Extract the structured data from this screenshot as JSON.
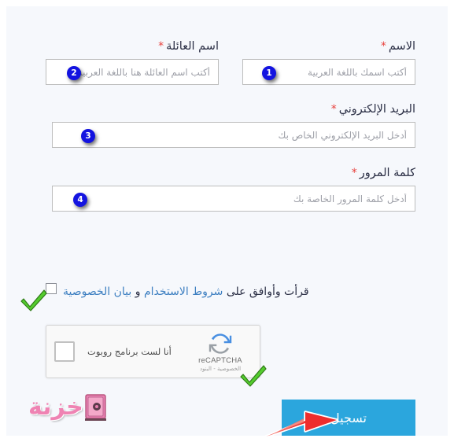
{
  "page": {
    "background_color": "#f6f8fc",
    "accent_blue": "#2ba6dd",
    "badge_color": "#1313e0",
    "link_color": "#3d7fc1",
    "required_color": "#e8413c"
  },
  "form": {
    "fields": [
      {
        "id": "first-name",
        "label": "الاسم",
        "required_mark": "*",
        "placeholder": "أكتب اسمك باللغة العربية",
        "value": "",
        "badge": "1"
      },
      {
        "id": "family-name",
        "label": "اسم العائلة",
        "required_mark": "*",
        "placeholder": "أكتب اسم العائلة هنا باللغة العربية",
        "value": "",
        "badge": "2"
      },
      {
        "id": "email",
        "label": "البريد الإلكتروني",
        "required_mark": "*",
        "placeholder": "أدخل البريد الإلكتروني الخاص بك",
        "value": "",
        "badge": "3"
      },
      {
        "id": "password",
        "label": "كلمة المرور",
        "required_mark": "*",
        "placeholder": "أدخل كلمة المرور الخاصة بك",
        "value": "",
        "badge": "4"
      }
    ],
    "terms": {
      "prefix": "قرأت وأوافق على",
      "link_terms": "شروط الاستخدام",
      "conjunction": "و",
      "link_privacy": "بيان الخصوصية",
      "checked": false
    },
    "recaptcha": {
      "label": "أنا لست برنامج روبوت",
      "brand": "reCAPTCHA",
      "legal": "الخصوصية - البنود",
      "checked": false
    },
    "submit": {
      "label": "تسجيل"
    }
  },
  "annotations": {
    "check_terms": "green-check",
    "check_captcha": "green-check",
    "arrow_submit": "red-arrow"
  },
  "watermark": {
    "text": "خزنة",
    "icon": "safe-icon"
  }
}
